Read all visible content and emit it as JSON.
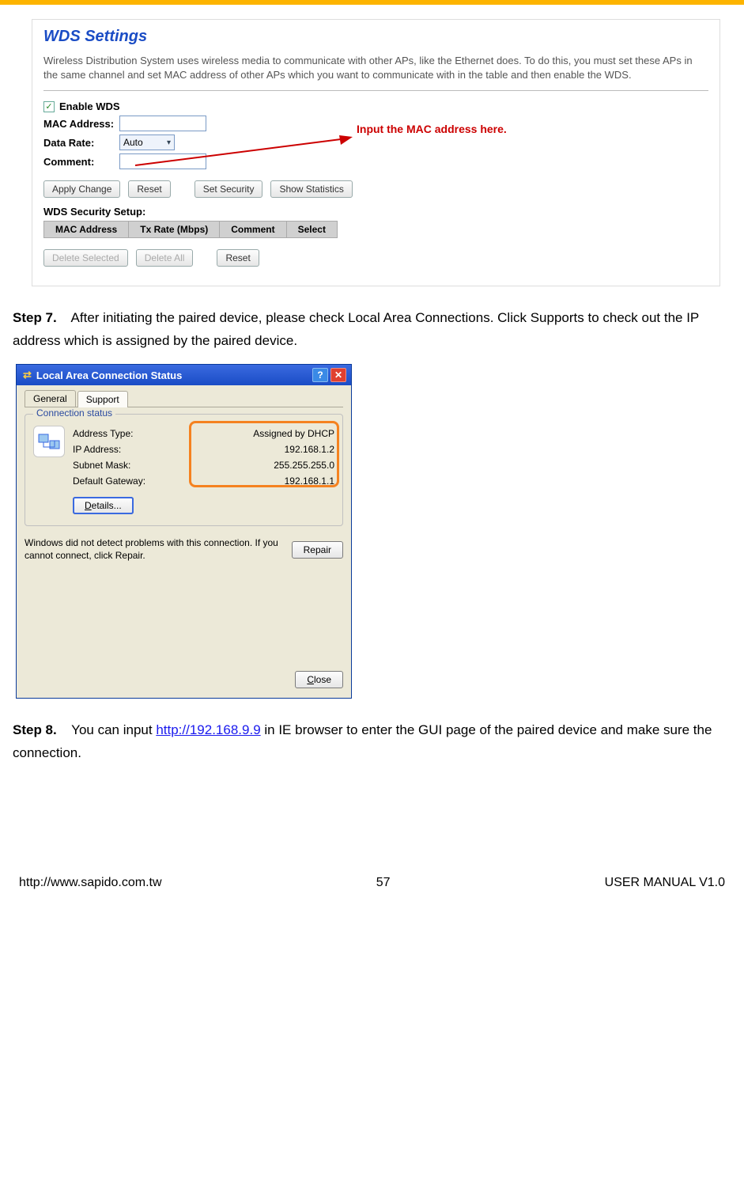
{
  "wds": {
    "title": "WDS Settings",
    "desc": "Wireless Distribution System uses wireless media to communicate with other APs, like the Ethernet does. To do this, you must set these APs in the same channel and set MAC address of other APs which you want to communicate with in the table and then enable the WDS.",
    "enable_label": "Enable WDS",
    "mac_label": "MAC Address:",
    "rate_label": "Data Rate:",
    "rate_value": "Auto",
    "comment_label": "Comment:",
    "buttons": {
      "apply": "Apply Change",
      "reset1": "Reset",
      "security": "Set Security",
      "stats": "Show Statistics",
      "del_sel": "Delete Selected",
      "del_all": "Delete All",
      "reset2": "Reset"
    },
    "sub_heading": "WDS Security Setup:",
    "cols": {
      "mac": "MAC Address",
      "tx": "Tx Rate (Mbps)",
      "comment": "Comment",
      "select": "Select"
    },
    "annotation": "Input the MAC address here."
  },
  "step7": {
    "label": "Step 7.",
    "text_a": "After initiating the paired device, please check Local Area Connections. Click Supports to check out the IP address which is assigned by the paired device."
  },
  "xp": {
    "title": "Local Area Connection Status",
    "tabs": {
      "general": "General",
      "support": "Support"
    },
    "fieldset_label": "Connection status",
    "rows": {
      "addr_type_l": "Address Type:",
      "addr_type_v": "Assigned by DHCP",
      "ip_l": "IP Address:",
      "ip_v": "192.168.1.2",
      "mask_l": "Subnet Mask:",
      "mask_v": "255.255.255.0",
      "gw_l": "Default Gateway:",
      "gw_v": "192.168.1.1"
    },
    "details_btn": "Details...",
    "repair_text": "Windows did not detect problems with this connection. If you cannot connect, click Repair.",
    "repair_btn": "Repair",
    "close_btn": "Close"
  },
  "step8": {
    "label": "Step 8.",
    "text_before": "You can input ",
    "link": "http://192.168.9.9",
    "text_after": " in IE browser to enter the GUI page of the paired device and make sure the connection."
  },
  "footer": {
    "left": "http://www.sapido.com.tw",
    "center": "57",
    "right": "USER MANUAL V1.0"
  }
}
